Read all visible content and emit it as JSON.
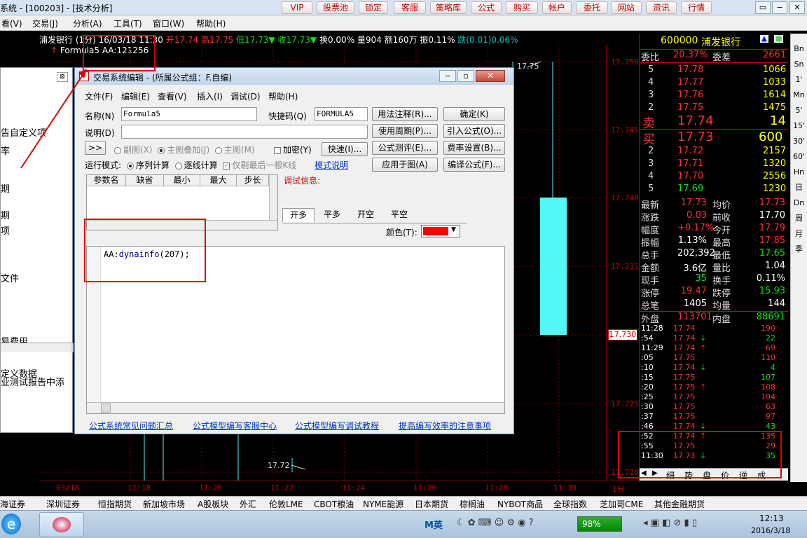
{
  "titlebar": {
    "title": "系统 - [100203] - [技术分析]",
    "buttons": [
      "VIP",
      "股票池",
      "锁定",
      "客服",
      "策略库",
      "公式",
      "购买",
      "帐户",
      "委托",
      "网站",
      "资讯",
      "行情"
    ],
    "win_controls": [
      "▭",
      "−",
      "▭",
      "✕"
    ]
  },
  "menubar": {
    "items": [
      "看(V)",
      "交易(J)",
      "分析(A)",
      "工具(T)",
      "窗口(W)",
      "帮助(H)"
    ]
  },
  "infobar": {
    "stock": "浦发银行 (1分) 16/03/18 11:30",
    "open": "开17.74",
    "high": "高17.75",
    "low": "低17.73▼",
    "close": "收17.73▼",
    "turnover": "换0.00%",
    "volume": "量904",
    "amount": "额160万",
    "amplitude": "振0.11%",
    "change": "跌(0.01)0.06%"
  },
  "formula_line": {
    "name": "Formula5",
    "value": "AA:121256"
  },
  "chart": {
    "price_labels": [
      "17.750",
      "17.745",
      "17.740",
      "17.735",
      "17.730",
      "17.725",
      "17.720"
    ],
    "current_price_label": "17.730",
    "high_label": "17.75",
    "low_label": "17.72",
    "time_labels": [
      "03/18",
      "11:18",
      "11:20",
      "11:22",
      "11:24",
      "11:26",
      "11:28",
      "11:30",
      "1分"
    ]
  },
  "quote_panel": {
    "code": "600000",
    "name": "浦发银行",
    "weibi_label": "委比",
    "weibi": "20.37%",
    "weicha_label": "委差",
    "weicha": "2661",
    "asks": [
      {
        "level": "5",
        "price": "17.78",
        "vol": "1066"
      },
      {
        "level": "4",
        "price": "17.77",
        "vol": "1033"
      },
      {
        "level": "3",
        "price": "17.76",
        "vol": "1614"
      },
      {
        "level": "2",
        "price": "17.75",
        "vol": "1475"
      }
    ],
    "sell1_label": "卖",
    "sell1_price": "17.74",
    "sell1_vol": "14",
    "buy1_label": "买",
    "buy1_price": "17.73",
    "buy1_vol": "600",
    "bids": [
      {
        "level": "2",
        "price": "17.72",
        "vol": "2157"
      },
      {
        "level": "3",
        "price": "17.71",
        "vol": "1320"
      },
      {
        "level": "4",
        "price": "17.70",
        "vol": "2556"
      },
      {
        "level": "5",
        "price": "17.69",
        "vol": "1230"
      }
    ],
    "stats": [
      {
        "l1": "最新",
        "v1": "17.73",
        "c1": "red",
        "l2": "均价",
        "v2": "17.73",
        "c2": "red"
      },
      {
        "l1": "涨跌",
        "v1": "0.03",
        "c1": "red",
        "l2": "前收",
        "v2": "17.70",
        "c2": "white"
      },
      {
        "l1": "幅度",
        "v1": "+0.17%",
        "c1": "red",
        "l2": "今开",
        "v2": "17.79",
        "c2": "red"
      },
      {
        "l1": "振幅",
        "v1": "1.13%",
        "c1": "white",
        "l2": "最高",
        "v2": "17.85",
        "c2": "red"
      },
      {
        "l1": "总手",
        "v1": "202,392",
        "c1": "white",
        "l2": "最低",
        "v2": "17.65",
        "c2": "green"
      },
      {
        "l1": "金额",
        "v1": "3.6亿",
        "c1": "white",
        "l2": "量比",
        "v2": "1.04",
        "c2": "white"
      },
      {
        "l1": "现手",
        "v1": "35",
        "c1": "green",
        "l2": "换手",
        "v2": "0.11%",
        "c2": "white"
      },
      {
        "l1": "涨停",
        "v1": "19.47",
        "c1": "red",
        "l2": "跌停",
        "v2": "15.93",
        "c2": "green"
      },
      {
        "l1": "总笔",
        "v1": "1405",
        "c1": "white",
        "l2": "均量",
        "v2": "144",
        "c2": "white"
      },
      {
        "l1": "外盘",
        "v1": "113701",
        "c1": "red",
        "l2": "内盘",
        "v2": "88691",
        "c2": "green"
      }
    ],
    "ticks": [
      {
        "time": "11:28",
        "price": "17.74",
        "arrow": "",
        "vol": "190",
        "vc": "red"
      },
      {
        "time": ":54",
        "price": "17.74",
        "arrow": "↓",
        "vol": "22",
        "vc": "green"
      },
      {
        "time": "11:29",
        "price": "17.74",
        "arrow": "↑",
        "vol": "69",
        "vc": "red"
      },
      {
        "time": ":05",
        "price": "17.75",
        "arrow": "",
        "vol": "110",
        "vc": "red"
      },
      {
        "time": ":10",
        "price": "17.74",
        "arrow": "↓",
        "vol": "4",
        "vc": "green"
      },
      {
        "time": ":15",
        "price": "17.75",
        "arrow": "",
        "vol": "107",
        "vc": "green"
      },
      {
        "time": ":20",
        "price": "17.75",
        "arrow": "↑",
        "vol": "108",
        "vc": "red"
      },
      {
        "time": ":25",
        "price": "17.75",
        "arrow": "",
        "vol": "104",
        "vc": "red"
      },
      {
        "time": ":30",
        "price": "17.75",
        "arrow": "",
        "vol": "63",
        "vc": "red"
      },
      {
        "time": ":37",
        "price": "17.75",
        "arrow": "",
        "vol": "97",
        "vc": "red"
      },
      {
        "time": ":46",
        "price": "17.74",
        "arrow": "↓",
        "vol": "43",
        "vc": "green"
      },
      {
        "time": ":52",
        "price": "17.74",
        "arrow": "↑",
        "vol": "135",
        "vc": "red"
      },
      {
        "time": ":55",
        "price": "17.75",
        "arrow": "",
        "vol": "29",
        "vc": "red"
      },
      {
        "time": "11:30",
        "price": "17.73",
        "arrow": "↓",
        "vol": "35",
        "vc": "green"
      }
    ],
    "bottom_tabs": [
      "细",
      "势",
      "盘",
      "价",
      "逆",
      "成"
    ]
  },
  "right_toolbar": [
    "Bn",
    "Sn",
    "1'",
    "Mn",
    "5'",
    "15'",
    "30'",
    "60'",
    "Hn",
    "日",
    "Dn",
    "周",
    "月",
    "季"
  ],
  "left_panel": {
    "items": [
      "告自定义项",
      "率",
      "期",
      "期",
      "项",
      "文件",
      "",
      "",
      "",
      "易费用",
      "定义数据",
      "业测试报告中添"
    ]
  },
  "dialog": {
    "title": "交易系统编辑 - (所属公式组：F.自编)",
    "menu": [
      "文件(F)",
      "编辑(E)",
      "查看(V)",
      "插入(I)",
      "调试(D)",
      "帮助(H)"
    ],
    "name_label": "名称(N)",
    "name_value": "Formula5",
    "shortcut_label": "快捷码(Q)",
    "shortcut_value": "FORMULA5",
    "desc_label": "说明(D)",
    "desc_value": "",
    "expand_btn": ">>",
    "chart_opts": [
      "副图(X)",
      "主图叠加(J)",
      "主图(M)"
    ],
    "encrypt_label": "加密(Y)",
    "fast_btn": "快速(I)...",
    "run_mode_label": "运行模式:",
    "run_opts": [
      "序列计算",
      "逐线计算"
    ],
    "last_bar_label": "仅剔最后一根K线",
    "mode_desc_link": "模式说明",
    "right_buttons": [
      "用法注释(R)...",
      "确定(K)",
      "使用周期(P)...",
      "引入公式(O)...",
      "公式测评(E)...",
      "费率设置(B)...",
      "应用于图(A)",
      "编译公式(F)..."
    ],
    "param_headers": [
      "参数名",
      "缺省",
      "最小",
      "最大",
      "步长"
    ],
    "debug_label": "调试信息:",
    "cond_tabs": [
      "开多",
      "平多",
      "开空",
      "平空"
    ],
    "color_label": "颜色(T):",
    "color_value": "#ff0000",
    "code_prefix": "AA:",
    "code_func": "dynainfo",
    "code_args": "(207);",
    "links": [
      "公式系统常见问题汇总",
      "公式模型编写客服中心",
      "公式模型编写调试教程",
      "提高编写效率的注意事项"
    ]
  },
  "bottom_tabs": [
    "海证券",
    "深圳证券",
    "恒指期货",
    "新加坡市场",
    "A股板块",
    "外汇",
    "伦敦LME",
    "CBOT粮油",
    "NYME能源",
    "日本期货",
    "棕榈油",
    "NYBOT商品",
    "全球指数",
    "芝加哥CME",
    "其他金融期货"
  ],
  "taskbar": {
    "ime": "M英",
    "battery": "98%",
    "time": "12:13",
    "date": "2016/3/18"
  }
}
